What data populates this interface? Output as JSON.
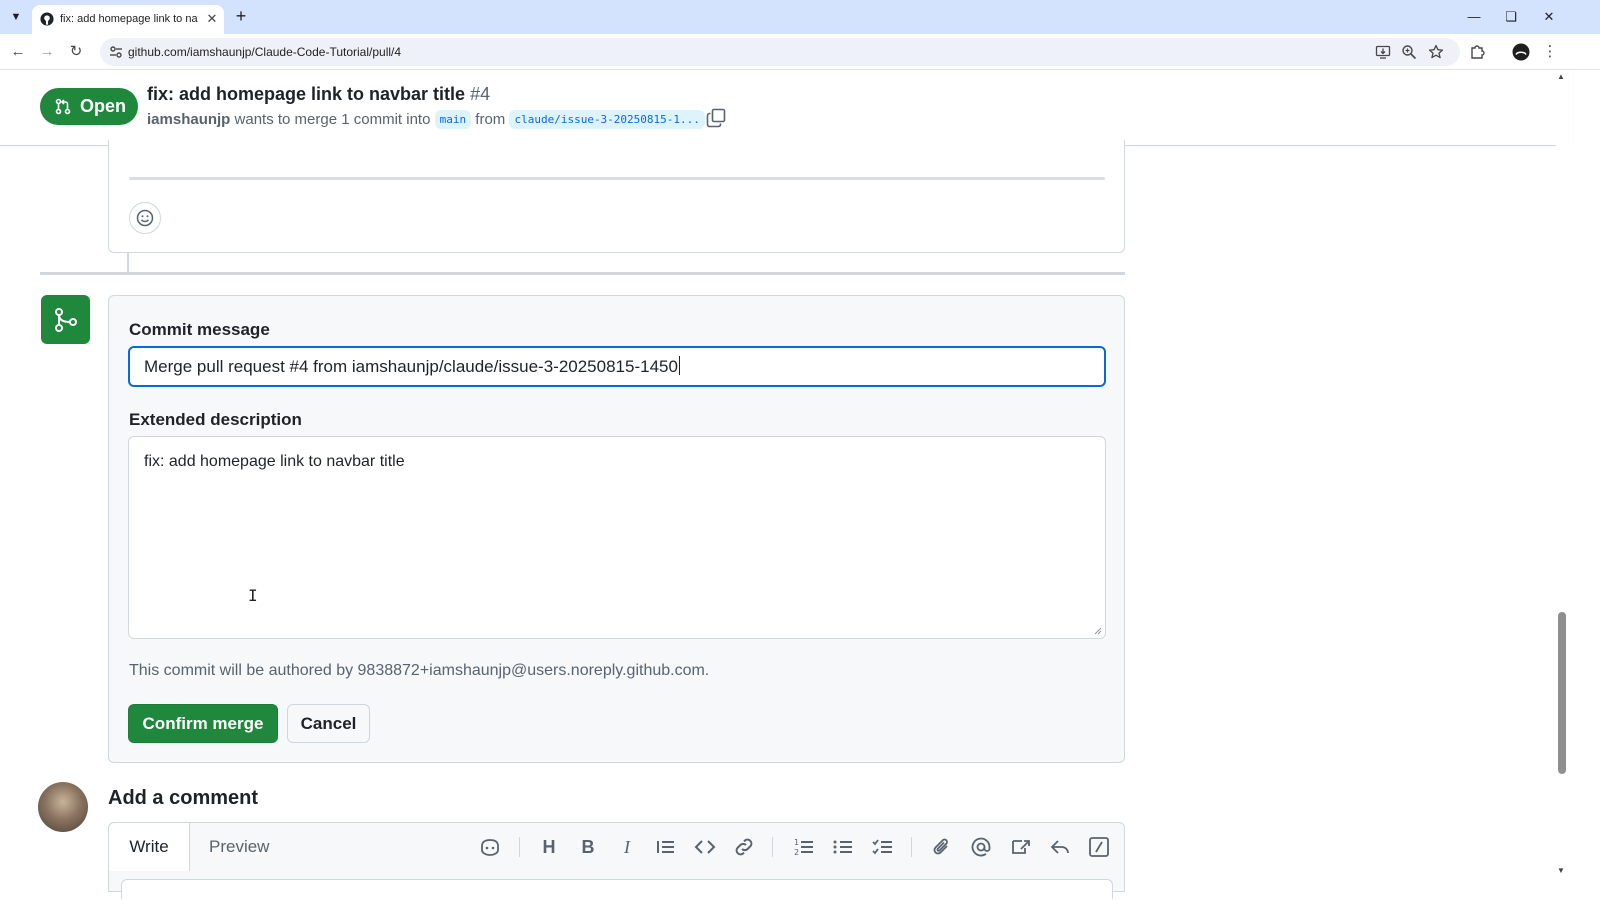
{
  "browser": {
    "tab_title": "fix: add homepage link to navbar title",
    "url": "github.com/iamshaunjp/Claude-Code-Tutorial/pull/4"
  },
  "pr": {
    "state": "Open",
    "title": "fix: add homepage link to navbar title",
    "number": "#4",
    "author": "iamshaunjp",
    "meta_mid": "wants to merge 1 commit into",
    "base_branch": "main",
    "meta_from": "from",
    "head_branch": "claude/issue-3-20250815-1..."
  },
  "merge": {
    "commit_label": "Commit message",
    "commit_value": "Merge pull request #4 from iamshaunjp/claude/issue-3-20250815-1450",
    "desc_label": "Extended description",
    "desc_value": "fix: add homepage link to navbar title",
    "author_note": "This commit will be authored by 9838872+iamshaunjp@users.noreply.github.com.",
    "confirm_label": "Confirm merge",
    "cancel_label": "Cancel"
  },
  "comment": {
    "title": "Add a comment",
    "tab_write": "Write",
    "tab_preview": "Preview"
  },
  "colors": {
    "primary_green": "#1f883d",
    "focus_blue": "#0969da",
    "border": "#d0d7de",
    "muted": "#59636e"
  }
}
